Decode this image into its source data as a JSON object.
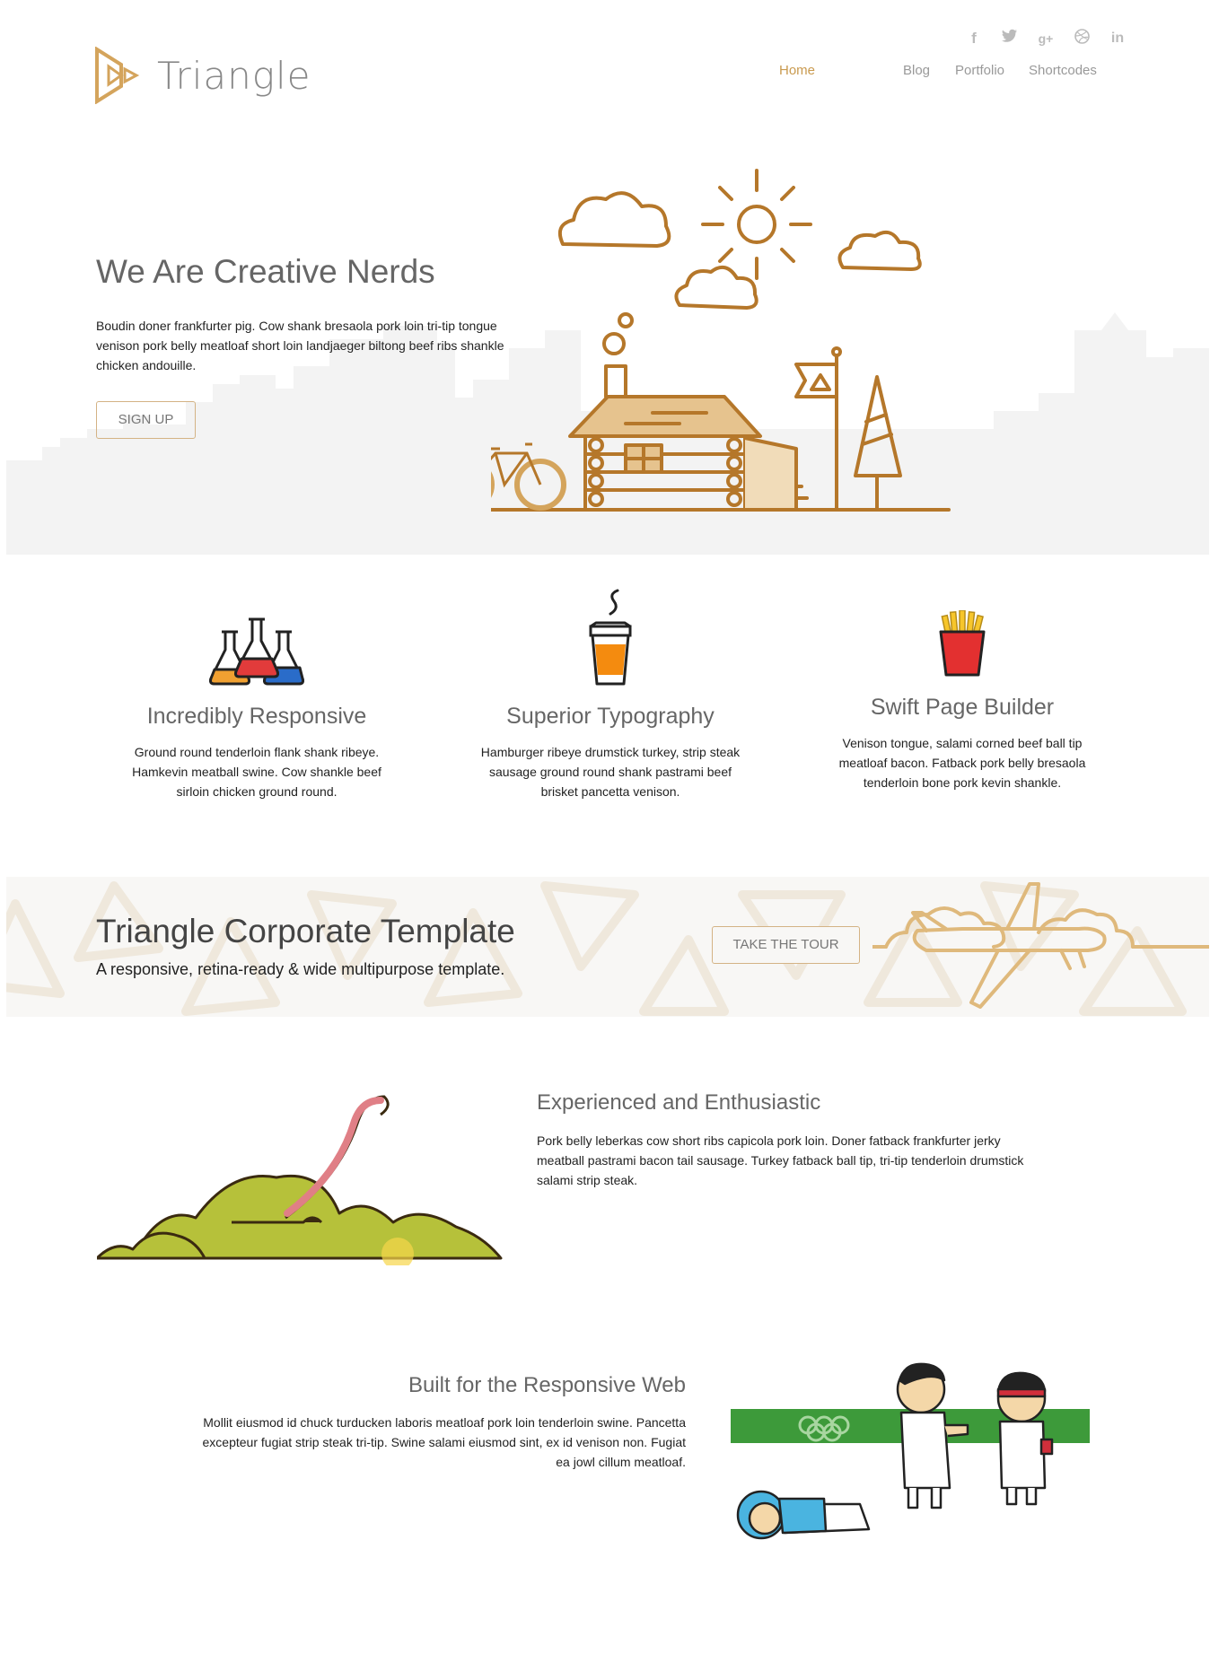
{
  "header": {
    "brand": "Triangle",
    "nav": [
      {
        "label": "Home",
        "active": true
      },
      {
        "label": "Blog",
        "active": false
      },
      {
        "label": "Portfolio",
        "active": false
      },
      {
        "label": "Shortcodes",
        "active": false
      }
    ],
    "social_icons": [
      "facebook-icon",
      "twitter-icon",
      "google-plus-icon",
      "dribbble-icon",
      "linkedin-icon"
    ]
  },
  "hero": {
    "title": "We Are Creative Nerds",
    "text": "Boudin doner frankfurter pig. Cow shank bresaola pork loin tri-tip tongue venison pork belly meatloaf short loin landjaeger biltong beef ribs shankle chicken andouille.",
    "button": "SIGN UP"
  },
  "features": [
    {
      "icon": "flasks-icon",
      "title": "Incredibly Responsive",
      "text": "Ground round tenderloin flank shank ribeye. Hamkevin meatball swine. Cow shankle beef sirloin chicken ground round."
    },
    {
      "icon": "coffee-cup-icon",
      "title": "Superior Typography",
      "text": "Hamburger ribeye drumstick turkey, strip steak sausage ground round shank pastrami beef brisket pancetta venison."
    },
    {
      "icon": "fries-icon",
      "title": "Swift Page Builder",
      "text": "Venison tongue, salami corned beef ball tip meatloaf bacon. Fatback pork belly bresaola tenderloin bone pork kevin shankle."
    }
  ],
  "banner": {
    "title": "Triangle Corporate Template",
    "subtitle": "A responsive, retina-ready & wide multipurpose template.",
    "button": "TAKE THE TOUR"
  },
  "section1": {
    "title": "Experienced and Enthusiastic",
    "text": "Pork belly leberkas cow short ribs capicola pork loin. Doner fatback frankfurter jerky meatball pastrami bacon tail sausage. Turkey fatback ball tip, tri-tip tenderloin drumstick salami strip steak."
  },
  "section2": {
    "title": "Built for the Responsive Web",
    "text": "Mollit eiusmod id chuck turducken laboris meatloaf pork loin tenderloin swine. Pancetta excepteur fugiat strip steak tri-tip. Swine salami eiusmod sint, ex id venison non. Fugiat ea jowl cillum meatloaf."
  },
  "colors": {
    "accent": "#c99a4f",
    "line_art": "#b5772a",
    "muted_text": "#999999"
  }
}
